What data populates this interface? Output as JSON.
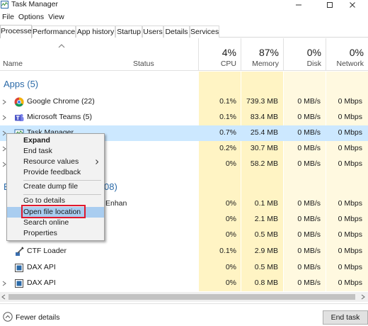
{
  "window": {
    "title": "Task Manager"
  },
  "menu": [
    "File",
    "Options",
    "View"
  ],
  "tabs": [
    "Processes",
    "Performance",
    "App history",
    "Startup",
    "Users",
    "Details",
    "Services"
  ],
  "columns": {
    "name": "Name",
    "status": "Status",
    "cpu": {
      "pct": "4%",
      "label": "CPU"
    },
    "memory": {
      "pct": "87%",
      "label": "Memory"
    },
    "disk": {
      "pct": "0%",
      "label": "Disk"
    },
    "network": {
      "pct": "0%",
      "label": "Network"
    }
  },
  "sections": {
    "apps": "Apps (5)",
    "background_fragment": "08)"
  },
  "rows": [
    {
      "name": "Google Chrome (22)",
      "cpu": "0.1%",
      "memory": "739.3 MB",
      "disk": "0 MB/s",
      "network": "0 Mbps",
      "icon": "chrome-icon"
    },
    {
      "name": "Microsoft Teams (5)",
      "cpu": "0.1%",
      "memory": "83.4 MB",
      "disk": "0 MB/s",
      "network": "0 Mbps",
      "icon": "teams-icon"
    },
    {
      "name": "Task Manager",
      "cpu": "0.7%",
      "memory": "25.4 MB",
      "disk": "0 MB/s",
      "network": "0 Mbps",
      "icon": "task-manager-icon"
    },
    {
      "name": "",
      "cpu": "0.2%",
      "memory": "30.7 MB",
      "disk": "0 MB/s",
      "network": "0 Mbps"
    },
    {
      "name": "",
      "cpu": "0%",
      "memory": "58.2 MB",
      "disk": "0 MB/s",
      "network": "0 Mbps"
    },
    {
      "name": "Enhan",
      "cpu": "0%",
      "memory": "0.1 MB",
      "disk": "0 MB/s",
      "network": "0 Mbps"
    },
    {
      "name": "",
      "cpu": "0%",
      "memory": "2.1 MB",
      "disk": "0 MB/s",
      "network": "0 Mbps"
    },
    {
      "name": "",
      "cpu": "0%",
      "memory": "0.5 MB",
      "disk": "0 MB/s",
      "network": "0 Mbps"
    },
    {
      "name": "CTF Loader",
      "cpu": "0.1%",
      "memory": "2.9 MB",
      "disk": "0 MB/s",
      "network": "0 Mbps",
      "icon": "ctf-loader-icon"
    },
    {
      "name": "DAX API",
      "cpu": "0%",
      "memory": "0.5 MB",
      "disk": "0 MB/s",
      "network": "0 Mbps",
      "icon": "dax-api-icon"
    },
    {
      "name": "DAX API",
      "cpu": "0%",
      "memory": "0.8 MB",
      "disk": "0 MB/s",
      "network": "0 Mbps",
      "icon": "dax-api-icon"
    }
  ],
  "context_menu": [
    "Expand",
    "End task",
    "Resource values",
    "Provide feedback",
    "Create dump file",
    "Go to details",
    "Open file location",
    "Search online",
    "Properties"
  ],
  "footer": {
    "fewer_details": "Fewer details",
    "end_task": "End task"
  },
  "colors": {
    "selected_row": "#cce8ff",
    "menu_highlight": "#a9cdf0",
    "annotation_box": "#e0182d",
    "usage_tint": "#fff4c4"
  }
}
